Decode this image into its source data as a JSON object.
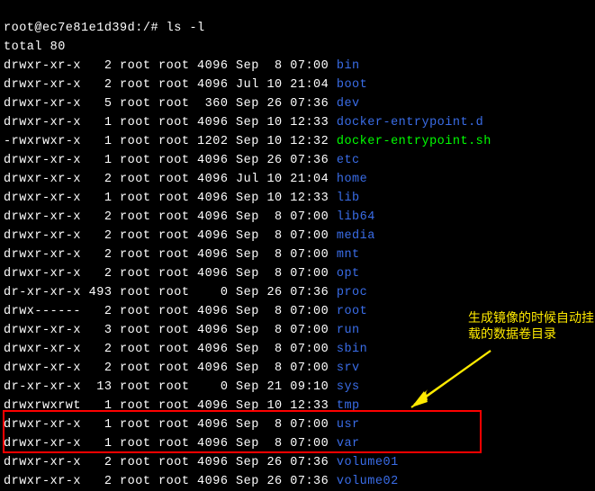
{
  "prompt": {
    "left": "root@ec7e81e1d39d",
    "sep": ":",
    "path": "/",
    "hash": "# ",
    "cmd": "ls -l"
  },
  "total": "total 80",
  "rows": [
    {
      "perm": "drwxr-xr-x",
      "links": "2",
      "owner": "root",
      "group": "root",
      "size": "4096",
      "month": "Sep",
      "day": "8",
      "time": "07:00",
      "name": "bin",
      "cls": "blue"
    },
    {
      "perm": "drwxr-xr-x",
      "links": "2",
      "owner": "root",
      "group": "root",
      "size": "4096",
      "month": "Jul",
      "day": "10",
      "time": "21:04",
      "name": "boot",
      "cls": "blue"
    },
    {
      "perm": "drwxr-xr-x",
      "links": "5",
      "owner": "root",
      "group": "root",
      "size": "360",
      "month": "Sep",
      "day": "26",
      "time": "07:36",
      "name": "dev",
      "cls": "blue"
    },
    {
      "perm": "drwxr-xr-x",
      "links": "1",
      "owner": "root",
      "group": "root",
      "size": "4096",
      "month": "Sep",
      "day": "10",
      "time": "12:33",
      "name": "docker-entrypoint.d",
      "cls": "blue"
    },
    {
      "perm": "-rwxrwxr-x",
      "links": "1",
      "owner": "root",
      "group": "root",
      "size": "1202",
      "month": "Sep",
      "day": "10",
      "time": "12:32",
      "name": "docker-entrypoint.sh",
      "cls": "green"
    },
    {
      "perm": "drwxr-xr-x",
      "links": "1",
      "owner": "root",
      "group": "root",
      "size": "4096",
      "month": "Sep",
      "day": "26",
      "time": "07:36",
      "name": "etc",
      "cls": "blue"
    },
    {
      "perm": "drwxr-xr-x",
      "links": "2",
      "owner": "root",
      "group": "root",
      "size": "4096",
      "month": "Jul",
      "day": "10",
      "time": "21:04",
      "name": "home",
      "cls": "blue"
    },
    {
      "perm": "drwxr-xr-x",
      "links": "1",
      "owner": "root",
      "group": "root",
      "size": "4096",
      "month": "Sep",
      "day": "10",
      "time": "12:33",
      "name": "lib",
      "cls": "blue"
    },
    {
      "perm": "drwxr-xr-x",
      "links": "2",
      "owner": "root",
      "group": "root",
      "size": "4096",
      "month": "Sep",
      "day": "8",
      "time": "07:00",
      "name": "lib64",
      "cls": "blue"
    },
    {
      "perm": "drwxr-xr-x",
      "links": "2",
      "owner": "root",
      "group": "root",
      "size": "4096",
      "month": "Sep",
      "day": "8",
      "time": "07:00",
      "name": "media",
      "cls": "blue"
    },
    {
      "perm": "drwxr-xr-x",
      "links": "2",
      "owner": "root",
      "group": "root",
      "size": "4096",
      "month": "Sep",
      "day": "8",
      "time": "07:00",
      "name": "mnt",
      "cls": "blue"
    },
    {
      "perm": "drwxr-xr-x",
      "links": "2",
      "owner": "root",
      "group": "root",
      "size": "4096",
      "month": "Sep",
      "day": "8",
      "time": "07:00",
      "name": "opt",
      "cls": "blue"
    },
    {
      "perm": "dr-xr-xr-x",
      "links": "493",
      "owner": "root",
      "group": "root",
      "size": "0",
      "month": "Sep",
      "day": "26",
      "time": "07:36",
      "name": "proc",
      "cls": "blue"
    },
    {
      "perm": "drwx------",
      "links": "2",
      "owner": "root",
      "group": "root",
      "size": "4096",
      "month": "Sep",
      "day": "8",
      "time": "07:00",
      "name": "root",
      "cls": "blue"
    },
    {
      "perm": "drwxr-xr-x",
      "links": "3",
      "owner": "root",
      "group": "root",
      "size": "4096",
      "month": "Sep",
      "day": "8",
      "time": "07:00",
      "name": "run",
      "cls": "blue"
    },
    {
      "perm": "drwxr-xr-x",
      "links": "2",
      "owner": "root",
      "group": "root",
      "size": "4096",
      "month": "Sep",
      "day": "8",
      "time": "07:00",
      "name": "sbin",
      "cls": "blue"
    },
    {
      "perm": "drwxr-xr-x",
      "links": "2",
      "owner": "root",
      "group": "root",
      "size": "4096",
      "month": "Sep",
      "day": "8",
      "time": "07:00",
      "name": "srv",
      "cls": "blue"
    },
    {
      "perm": "dr-xr-xr-x",
      "links": "13",
      "owner": "root",
      "group": "root",
      "size": "0",
      "month": "Sep",
      "day": "21",
      "time": "09:10",
      "name": "sys",
      "cls": "blue"
    },
    {
      "perm": "drwxrwxrwt",
      "links": "1",
      "owner": "root",
      "group": "root",
      "size": "4096",
      "month": "Sep",
      "day": "10",
      "time": "12:33",
      "name": "tmp",
      "cls": "blue"
    },
    {
      "perm": "drwxr-xr-x",
      "links": "1",
      "owner": "root",
      "group": "root",
      "size": "4096",
      "month": "Sep",
      "day": "8",
      "time": "07:00",
      "name": "usr",
      "cls": "blue"
    },
    {
      "perm": "drwxr-xr-x",
      "links": "1",
      "owner": "root",
      "group": "root",
      "size": "4096",
      "month": "Sep",
      "day": "8",
      "time": "07:00",
      "name": "var",
      "cls": "blue"
    },
    {
      "perm": "drwxr-xr-x",
      "links": "2",
      "owner": "root",
      "group": "root",
      "size": "4096",
      "month": "Sep",
      "day": "26",
      "time": "07:36",
      "name": "volume01",
      "cls": "blue"
    },
    {
      "perm": "drwxr-xr-x",
      "links": "2",
      "owner": "root",
      "group": "root",
      "size": "4096",
      "month": "Sep",
      "day": "26",
      "time": "07:36",
      "name": "volume02",
      "cls": "blue"
    }
  ],
  "annotation": {
    "line1": "生成镜像的时候自动挂",
    "line2": "载的数据卷目录"
  },
  "colors": {
    "arrow": "#ffea00",
    "highlight": "#ff0000"
  }
}
